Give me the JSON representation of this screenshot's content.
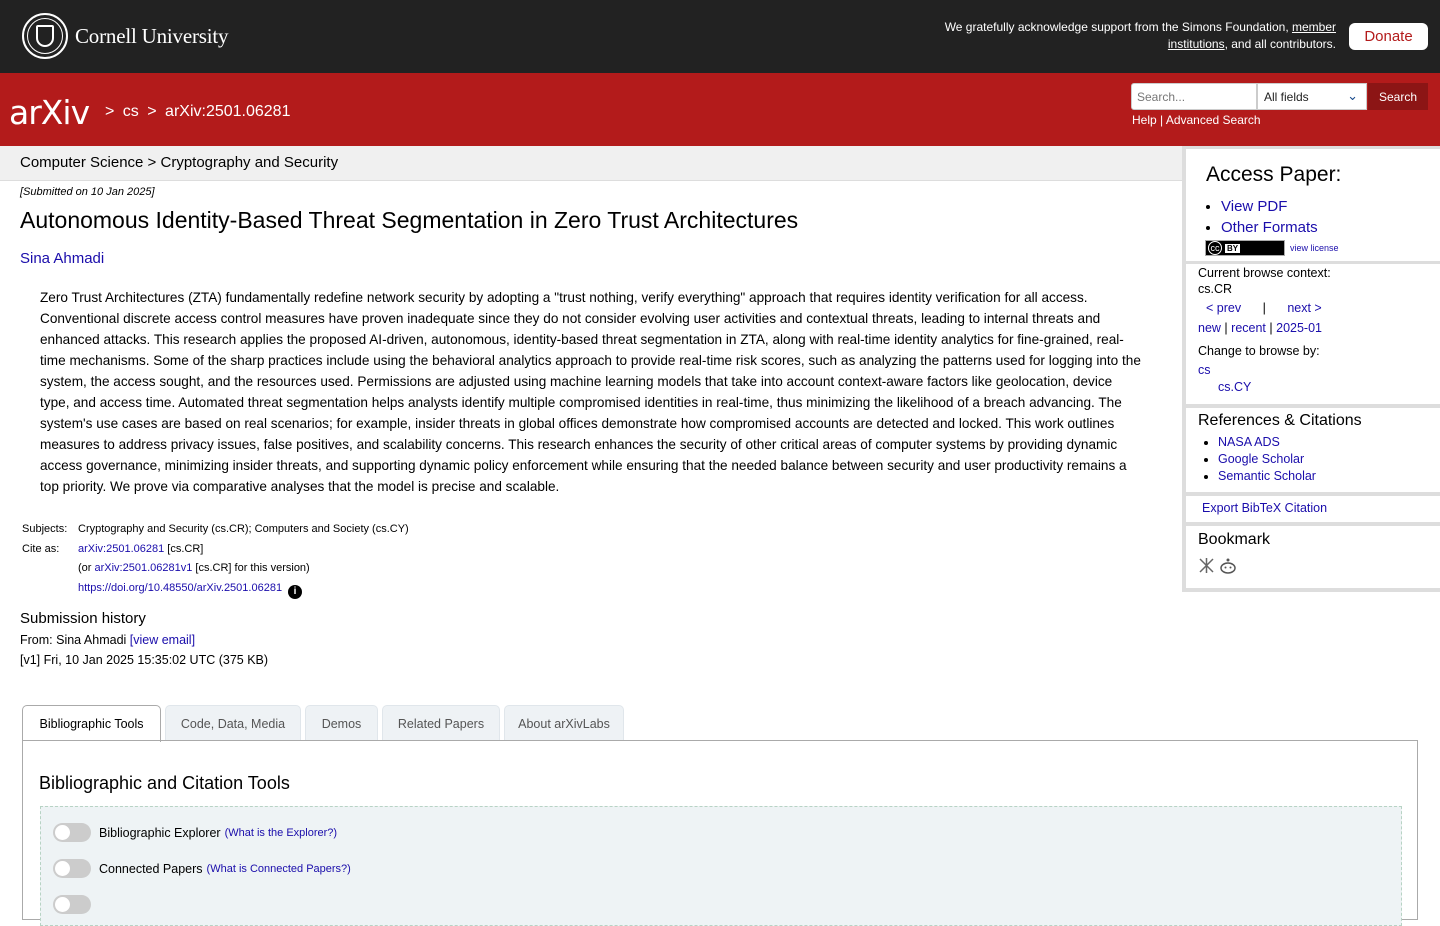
{
  "top": {
    "university": "Cornell University",
    "support_pre": "We gratefully acknowledge support from the Simons Foundation, ",
    "support_link": "member institutions",
    "support_post": ", and all contributors.",
    "donate": "Donate"
  },
  "header": {
    "logo": "arXiv",
    "crumb_sep": ">",
    "crumb_cs": "cs",
    "crumb_id": "arXiv:2501.06281",
    "search_placeholder": "Search...",
    "search_field": "All fields",
    "search_button": "Search",
    "help": "Help",
    "pipe": "|",
    "advanced": "Advanced Search"
  },
  "subheader": "Computer Science > Cryptography and Security",
  "paper": {
    "submitted": "[Submitted on 10 Jan 2025]",
    "title": "Autonomous Identity-Based Threat Segmentation in Zero Trust Architectures",
    "author": "Sina Ahmadi",
    "abstract": "Zero Trust Architectures (ZTA) fundamentally redefine network security by adopting a \"trust nothing, verify everything\" approach that requires identity verification for all access. Conventional discrete access control measures have proven inadequate since they do not consider evolving user activities and contextual threats, leading to internal threats and enhanced attacks. This research applies the proposed AI-driven, autonomous, identity-based threat segmentation in ZTA, along with real-time identity analytics for fine-grained, real-time mechanisms. Some of the sharp practices include using the behavioral analytics approach to provide real-time risk scores, such as analyzing the patterns used for logging into the system, the access sought, and the resources used. Permissions are adjusted using machine learning models that take into account context-aware factors like geolocation, device type, and access time. Automated threat segmentation helps analysts identify multiple compromised identities in real-time, thus minimizing the likelihood of a breach advancing. The system's use cases are based on real scenarios; for example, insider threats in global offices demonstrate how compromised accounts are detected and locked. This work outlines measures to address privacy issues, false positives, and scalability concerns. This research enhances the security of other critical areas of computer systems by providing dynamic access governance, minimizing insider threats, and supporting dynamic policy enforcement while ensuring that the needed balance between security and user productivity remains a top priority. We prove via comparative analyses that the model is precise and scalable."
  },
  "meta": {
    "subjects_label": "Subjects:",
    "subjects": "Cryptography and Security (cs.CR); Computers and Society (cs.CY)",
    "cite_label": "Cite as:",
    "cite_link": "arXiv:2501.06281",
    "cite_tag": " [cs.CR]",
    "or_pre": "(or ",
    "or_link": "arXiv:2501.06281v1",
    "or_post": " [cs.CR] for this version)",
    "doi": "https://doi.org/10.48550/arXiv.2501.06281",
    "info_icon": "i"
  },
  "history": {
    "title": "Submission history",
    "from_pre": "From: Sina Ahmadi ",
    "view_email": "[view email]",
    "v1": "[v1] Fri, 10 Jan 2025 15:35:02 UTC (375 KB)"
  },
  "sidebar": {
    "access_title": "Access Paper:",
    "view_pdf": "View PDF",
    "other_formats": "Other Formats",
    "view_license": "view license",
    "cc": "BY",
    "context_label": "Current browse context:",
    "context": "cs.CR",
    "prev": "< prev",
    "sep": "|",
    "next": "next >",
    "new": "new",
    "recent": "recent",
    "month": "2025-01",
    "change_label": "Change to browse by:",
    "cs": "cs",
    "cscy": "cs.CY",
    "refs_title": "References & Citations",
    "nasa": "NASA ADS",
    "google": "Google Scholar",
    "semantic": "Semantic Scholar",
    "bibtex": "Export BibTeX Citation",
    "bookmark": "Bookmark"
  },
  "tabs": [
    "Bibliographic Tools",
    "Code, Data, Media",
    "Demos",
    "Related Papers",
    "About arXivLabs"
  ],
  "panel": {
    "title": "Bibliographic and Citation Tools",
    "tools": [
      {
        "label": "Bibliographic Explorer",
        "q": "(What is the Explorer?)"
      },
      {
        "label": "Connected Papers",
        "q": "(What is Connected Papers?)"
      }
    ]
  }
}
